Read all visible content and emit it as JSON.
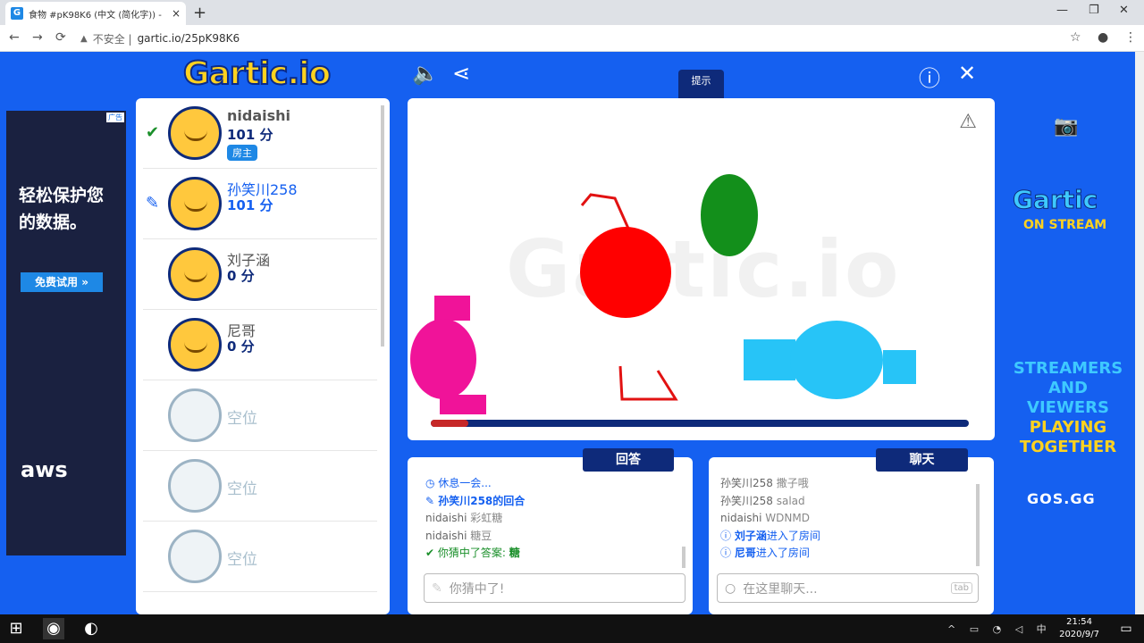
{
  "browser": {
    "tab_title": "食物 #pK98K6 (中文 (简化字)) -",
    "tab_close": "×",
    "new_tab": "+",
    "favicon": "G",
    "insecure_label": "不安全 |",
    "url": "gartic.io/25pK98K6",
    "window_controls": {
      "minimize": "—",
      "maximize": "❐",
      "close": "✕"
    },
    "nav": {
      "back": "←",
      "forward": "→",
      "reload": "⟳",
      "warning_icon": "▲"
    }
  },
  "game": {
    "logo": "Gartic",
    "logo_suffix": ".io",
    "hint_label": "提示",
    "hint_value": "_",
    "answers_label": "回答",
    "chat_label": "聊天",
    "progress_fraction": 0.07,
    "players": [
      {
        "name": "nidaishi",
        "score": "101 分",
        "badge": "房主",
        "status_icon": "check-icon",
        "state": "guessed"
      },
      {
        "name": "孙笑川258",
        "score": "101 分",
        "status_icon": "pencil-icon",
        "state": "drawing"
      },
      {
        "name": "刘子涵",
        "score": "0 分",
        "state": "waiting"
      },
      {
        "name": "尼哥",
        "score": "0 分",
        "state": "waiting"
      }
    ],
    "empty_slots": [
      "空位",
      "空位",
      "空位"
    ],
    "answers": [
      {
        "text": "休息一会...",
        "type": "sys"
      },
      {
        "text": "孙笑川258的回合",
        "type": "sys-bold"
      },
      {
        "user": "nidaishi",
        "text": "彩虹糖"
      },
      {
        "user": "nidaishi",
        "text": "糖豆"
      },
      {
        "text": "你猜中了答案: ",
        "answer": "糖",
        "type": "ok"
      }
    ],
    "answer_placeholder": "你猜中了!",
    "chat": [
      {
        "user": "孙笑川258",
        "text": "撒子哦"
      },
      {
        "user": "孙笑川258",
        "text": "salad"
      },
      {
        "user": "nidaishi",
        "text": "WDNMD"
      },
      {
        "bold": "刘子涵",
        "text": "进入了房间",
        "type": "sys"
      },
      {
        "bold": "尼哥",
        "text": "进入了房间",
        "type": "sys"
      }
    ],
    "chat_placeholder": "在这里聊天...",
    "chat_key": "tab"
  },
  "ads": {
    "left": {
      "badge": "广告",
      "headline_line1": "轻松保护您",
      "headline_line2": "的数据。",
      "cta": "免费试用 »",
      "brand": "aws"
    },
    "right": {
      "title": "Gartic",
      "subtitle": "ON STREAM",
      "slogan_1": "STREAMERS",
      "slogan_2": "AND VIEWERS",
      "slogan_3": "PLAYING",
      "slogan_4": "TOGETHER",
      "site": "GOS.GG"
    }
  },
  "taskbar": {
    "time": "21:54",
    "date": "2020/9/7",
    "ime": "中"
  },
  "colors": {
    "game_bg": "#1560f0",
    "navy": "#0e2a7a",
    "drawing_player": "#1560f0",
    "correct": "#1a8f2a",
    "timer": "#c62828"
  }
}
